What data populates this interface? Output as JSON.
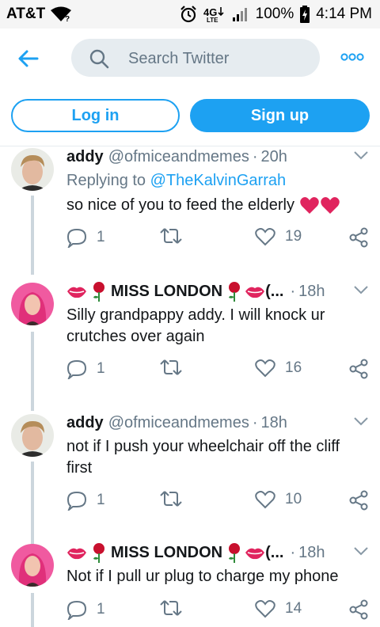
{
  "status_bar": {
    "carrier": "AT&T",
    "battery": "100%",
    "time": "4:14 PM"
  },
  "search": {
    "placeholder": "Search Twitter"
  },
  "auth": {
    "login_label": "Log in",
    "signup_label": "Sign up"
  },
  "colors": {
    "accent": "#1da1f2",
    "muted": "#657786",
    "divider": "#e6ecf0",
    "heart": "#e0245e"
  },
  "tweets": [
    {
      "name": "addy",
      "handle": "@ofmiceandmemes",
      "time": "20h",
      "replying_prefix": "Replying to",
      "replying_to": "@TheKalvinGarrah",
      "text": "so nice of you to feed the elderly",
      "replies": "1",
      "likes": "19"
    },
    {
      "name": "MISS LONDON",
      "name_suffix": "(...",
      "time": "18h",
      "text_line1": "Silly grandpappy addy. I will knock ur",
      "text_line2": "crutches over again",
      "replies": "1",
      "likes": "16"
    },
    {
      "name": "addy",
      "handle": "@ofmiceandmemes",
      "time": "18h",
      "text_line1": "not if I push your wheelchair off the cliff",
      "text_line2": "first",
      "replies": "1",
      "likes": "10"
    },
    {
      "name": "MISS LONDON",
      "name_suffix": "(...",
      "time": "18h",
      "text_line1": "Not if I pull ur plug to charge my phone",
      "replies": "1",
      "likes": "14"
    }
  ]
}
